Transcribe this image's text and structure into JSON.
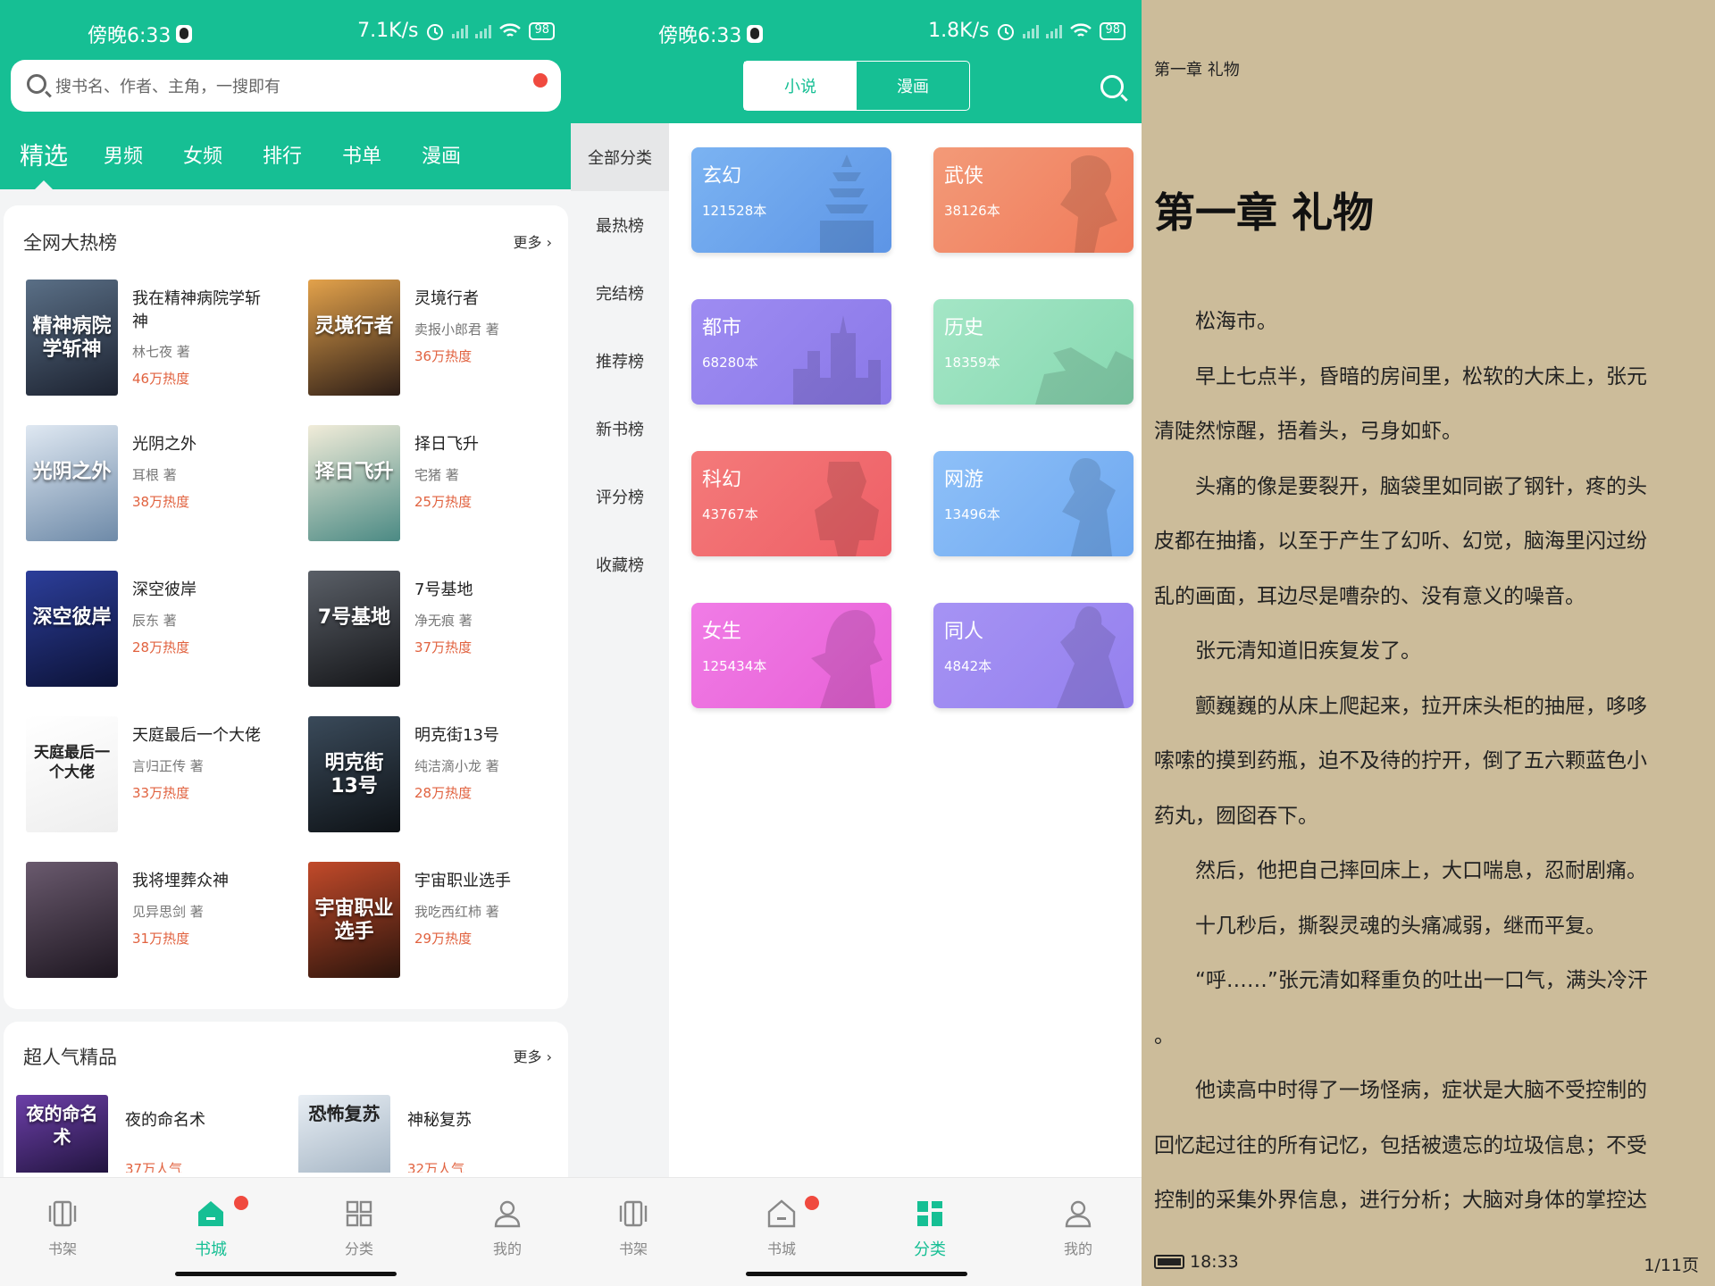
{
  "panel1": {
    "status": {
      "time": "傍晚6:33",
      "speed": "7.1K/s",
      "battery": "98"
    },
    "search_placeholder": "搜书名、作者、主角，一搜即有",
    "tabs": [
      "精选",
      "男频",
      "女频",
      "排行",
      "书单",
      "漫画"
    ],
    "section1": {
      "title": "全网大热榜",
      "more": "更多",
      "books": [
        {
          "title": "我在精神病院学斩神",
          "author": "林七夜 著",
          "heat": "46万热度",
          "cover_text": "精神病院学斩神",
          "c1": "#5a6f86",
          "c2": "#1c2230"
        },
        {
          "title": "灵境行者",
          "author": "卖报小郎君 著",
          "heat": "36万热度",
          "cover_text": "灵境行者",
          "c1": "#e3a24b",
          "c2": "#2b1c16"
        },
        {
          "title": "光阴之外",
          "author": "耳根 著",
          "heat": "38万热度",
          "cover_text": "光阴之外",
          "c1": "#dfe8f2",
          "c2": "#6e8aa8"
        },
        {
          "title": "择日飞升",
          "author": "宅猪 著",
          "heat": "25万热度",
          "cover_text": "择日飞升",
          "c1": "#f1ecd9",
          "c2": "#4b8a84"
        },
        {
          "title": "深空彼岸",
          "author": "辰东 著",
          "heat": "28万热度",
          "cover_text": "深空彼岸",
          "c1": "#2c3e9a",
          "c2": "#0c1236"
        },
        {
          "title": "7号基地",
          "author": "净无痕 著",
          "heat": "37万热度",
          "cover_text": "7号基地",
          "c1": "#5a5f67",
          "c2": "#141518"
        },
        {
          "title": "天庭最后一个大佬",
          "author": "言归正传 著",
          "heat": "33万热度",
          "cover_text": "天庭最后一个大佬",
          "c1": "#ffffff",
          "c2": "#eeeeee"
        },
        {
          "title": "明克街13号",
          "author": "纯洁滴小龙 著",
          "heat": "28万热度",
          "cover_text": "明克街13号",
          "c1": "#3a4a5a",
          "c2": "#0e1216"
        },
        {
          "title": "我将埋葬众神",
          "author": "见异思剑 著",
          "heat": "31万热度",
          "cover_text": "",
          "c1": "#6a5a6e",
          "c2": "#1d1620"
        },
        {
          "title": "宇宙职业选手",
          "author": "我吃西红柿 著",
          "heat": "29万热度",
          "cover_text": "宇宙职业选手",
          "c1": "#c24a2a",
          "c2": "#2a140c"
        }
      ]
    },
    "section2": {
      "title": "超人气精品",
      "more": "更多",
      "books": [
        {
          "title": "夜的命名术",
          "heat": "37万人气",
          "cover_text": "夜的命名术",
          "c1": "#6c3fa8",
          "c2": "#1a1034"
        },
        {
          "title": "神秘复苏",
          "heat": "32万人气",
          "cover_text": "恐怖复苏",
          "c1": "#e8eef4",
          "c2": "#9fb0c0"
        }
      ]
    },
    "bottom_nav": [
      "书架",
      "书城",
      "分类",
      "我的"
    ]
  },
  "panel2": {
    "status": {
      "time": "傍晚6:33",
      "speed": "1.8K/s",
      "battery": "98"
    },
    "segments": [
      "小说",
      "漫画"
    ],
    "sidebar": [
      "全部分类",
      "最热榜",
      "完结榜",
      "推荐榜",
      "新书榜",
      "评分榜",
      "收藏榜"
    ],
    "categories": [
      {
        "name": "玄幻",
        "count": "121528本",
        "c1": "#7bb3f2",
        "c2": "#5d95e6",
        "icon": "pagoda"
      },
      {
        "name": "武侠",
        "count": "38126本",
        "c1": "#f39a78",
        "c2": "#f07a5a",
        "icon": "swordsman"
      },
      {
        "name": "都市",
        "count": "68280本",
        "c1": "#9e8cf2",
        "c2": "#8a78e8",
        "icon": "city"
      },
      {
        "name": "历史",
        "count": "18359本",
        "c1": "#a4e6c6",
        "c2": "#86d8b0",
        "icon": "cannon"
      },
      {
        "name": "科幻",
        "count": "43767本",
        "c1": "#f47a7a",
        "c2": "#ee5f66",
        "icon": "robot"
      },
      {
        "name": "网游",
        "count": "13496本",
        "c1": "#8ec0f8",
        "c2": "#6ea8f0",
        "icon": "warrior"
      },
      {
        "name": "女生",
        "count": "125434本",
        "c1": "#f07ce6",
        "c2": "#e860d6",
        "icon": "woman"
      },
      {
        "name": "同人",
        "count": "4842本",
        "c1": "#a693f4",
        "c2": "#9480ee",
        "icon": "figure"
      }
    ],
    "bottom_nav": [
      "书架",
      "书城",
      "分类",
      "我的"
    ]
  },
  "panel3": {
    "header": "第一章 礼物",
    "chapter_title": "第一章 礼物",
    "lines": [
      {
        "t": "松海市。",
        "ind": true
      },
      {
        "t": "早上七点半，昏暗的房间里，松软的大床上，张元",
        "ind": true
      },
      {
        "t": "清陡然惊醒，捂着头，弓身如虾。",
        "ind": false
      },
      {
        "t": "头痛的像是要裂开，脑袋里如同嵌了钢针，疼的头",
        "ind": true
      },
      {
        "t": "皮都在抽搐，以至于产生了幻听、幻觉，脑海里闪过纷",
        "ind": false
      },
      {
        "t": "乱的画面，耳边尽是嘈杂的、没有意义的噪音。",
        "ind": false
      },
      {
        "t": "张元清知道旧疾复发了。",
        "ind": true
      },
      {
        "t": "颤巍巍的从床上爬起来，拉开床头柜的抽屉，哆哆",
        "ind": true
      },
      {
        "t": "嗦嗦的摸到药瓶，迫不及待的拧开，倒了五六颗蓝色小",
        "ind": false
      },
      {
        "t": "药丸，囫囵吞下。",
        "ind": false
      },
      {
        "t": "然后，他把自己摔回床上，大口喘息，忍耐剧痛。",
        "ind": true
      },
      {
        "t": "十几秒后，撕裂灵魂的头痛减弱，继而平复。",
        "ind": true
      },
      {
        "t": "“呼……”张元清如释重负的吐出一口气，满头冷汗",
        "ind": true
      },
      {
        "t": "。",
        "ind": false
      },
      {
        "t": "他读高中时得了一场怪病，症状是大脑不受控制的",
        "ind": true
      },
      {
        "t": "回忆起过往的所有记忆，包括被遗忘的垃圾信息；不受",
        "ind": false
      },
      {
        "t": "控制的采集外界信息，进行分析；大脑对身体的掌控达",
        "ind": false
      }
    ],
    "footer_time": "18:33",
    "footer_page": "1/11页"
  },
  "colors": {
    "accent": "#16bf94",
    "heat": "#e1623f",
    "badge": "#f04a3f",
    "paper": "#ccbc9a"
  }
}
